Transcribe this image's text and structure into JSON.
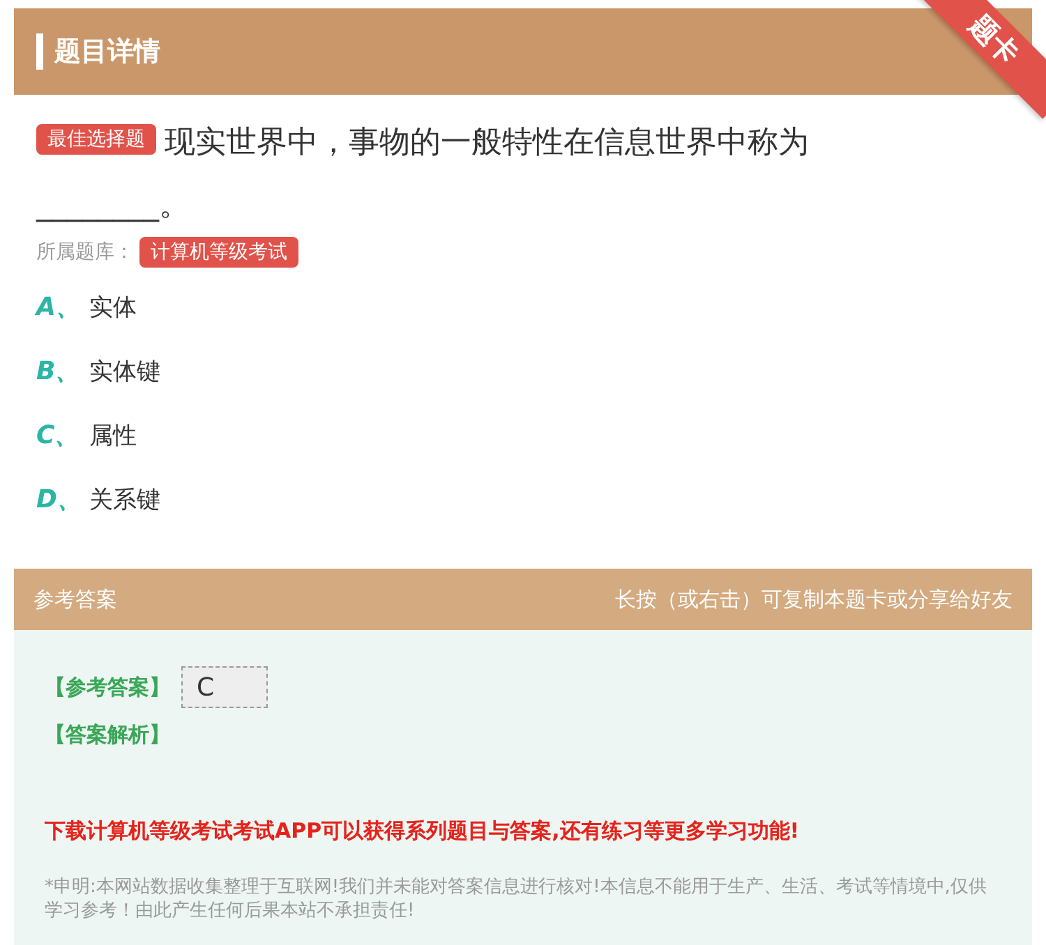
{
  "header": {
    "title": "题目详情",
    "ribbon": "题卡"
  },
  "question": {
    "type_badge": "最佳选择题",
    "text": "现实世界中，事物的一般特性在信息世界中称为",
    "blank": "________",
    "end": "。",
    "bank_label": "所属题库：",
    "bank": "计算机等级考试"
  },
  "options": [
    {
      "letter": "A、",
      "text": "实体"
    },
    {
      "letter": "B、",
      "text": "实体键"
    },
    {
      "letter": "C、",
      "text": "属性"
    },
    {
      "letter": "D、",
      "text": "关系键"
    }
  ],
  "answer": {
    "title": "参考答案",
    "hint": "长按（或右击）可复制本题卡或分享给好友",
    "answer_label": "【参考答案】",
    "answer_value": "C",
    "analysis_label": "【答案解析】",
    "promo": "下载计算机等级考试考试APP可以获得系列题目与答案,还有练习等更多学习功能!",
    "disclaimer": "*申明:本网站数据收集整理于互联网!我们并未能对答案信息进行核对!本信息不能用于生产、生活、考试等情境中,仅供学习参考！由此产生任何后果本站不承担责任!"
  }
}
